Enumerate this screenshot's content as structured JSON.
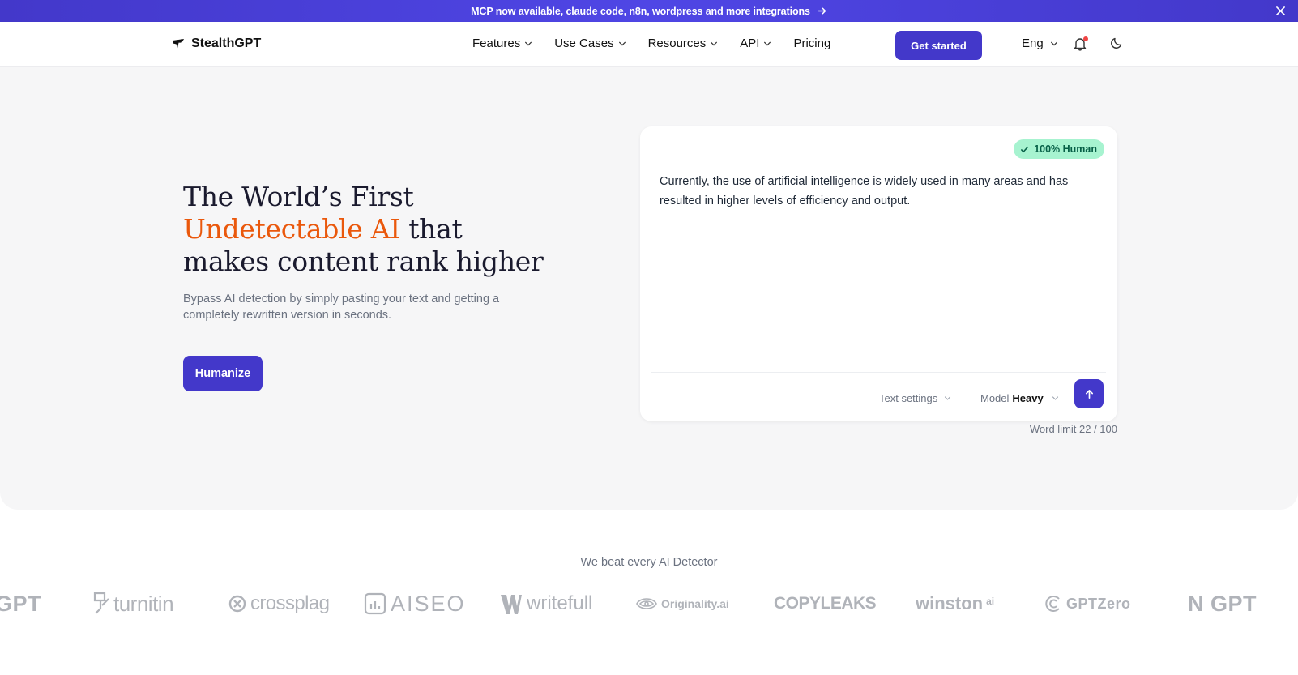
{
  "announcement": {
    "text": "MCP now available, claude code, n8n, wordpress and more integrations",
    "arrow_icon": "arrow-right-icon",
    "close_icon": "close-icon"
  },
  "nav": {
    "brand": "StealthGPT",
    "menu": [
      {
        "label": "Features",
        "has_dropdown": true
      },
      {
        "label": "Use Cases",
        "has_dropdown": true
      },
      {
        "label": "Resources",
        "has_dropdown": true
      },
      {
        "label": "API",
        "has_dropdown": true
      },
      {
        "label": "Pricing",
        "has_dropdown": false
      }
    ],
    "cta": "Get started",
    "language": "Eng",
    "notification_icon": "bell-icon",
    "theme_icon": "moon-icon"
  },
  "hero": {
    "headline_part1": "The World’s First",
    "headline_accent": "Undetectable AI",
    "headline_part2": " that",
    "headline_part3": "makes content rank higher",
    "subtext": "Bypass AI detection by simply pasting your text and getting a completely rewritten version in seconds.",
    "button": "Humanize",
    "accent_color": "#ea580c",
    "brand_color": "#4338ca"
  },
  "editor": {
    "badge": "100% Human",
    "text": "Currently, the use of artificial intelligence is widely used in many areas and has resulted in higher levels of efficiency and output.",
    "text_settings": "Text settings",
    "model_label": "Model",
    "model_value": "Heavy",
    "word_limit": "Word limit 22 / 100"
  },
  "detectors": {
    "heading": "We beat every AI Detector",
    "items": [
      {
        "name": "GPT"
      },
      {
        "name": "turnitin"
      },
      {
        "name": "crossplag"
      },
      {
        "name": "AISEO"
      },
      {
        "name": "writefull"
      },
      {
        "name": "Originality.ai"
      },
      {
        "name": "COPYLEAKS"
      },
      {
        "name": "winston"
      },
      {
        "name": "GPTZero"
      },
      {
        "name": "N GPT"
      }
    ],
    "winston_suffix": "ai"
  }
}
